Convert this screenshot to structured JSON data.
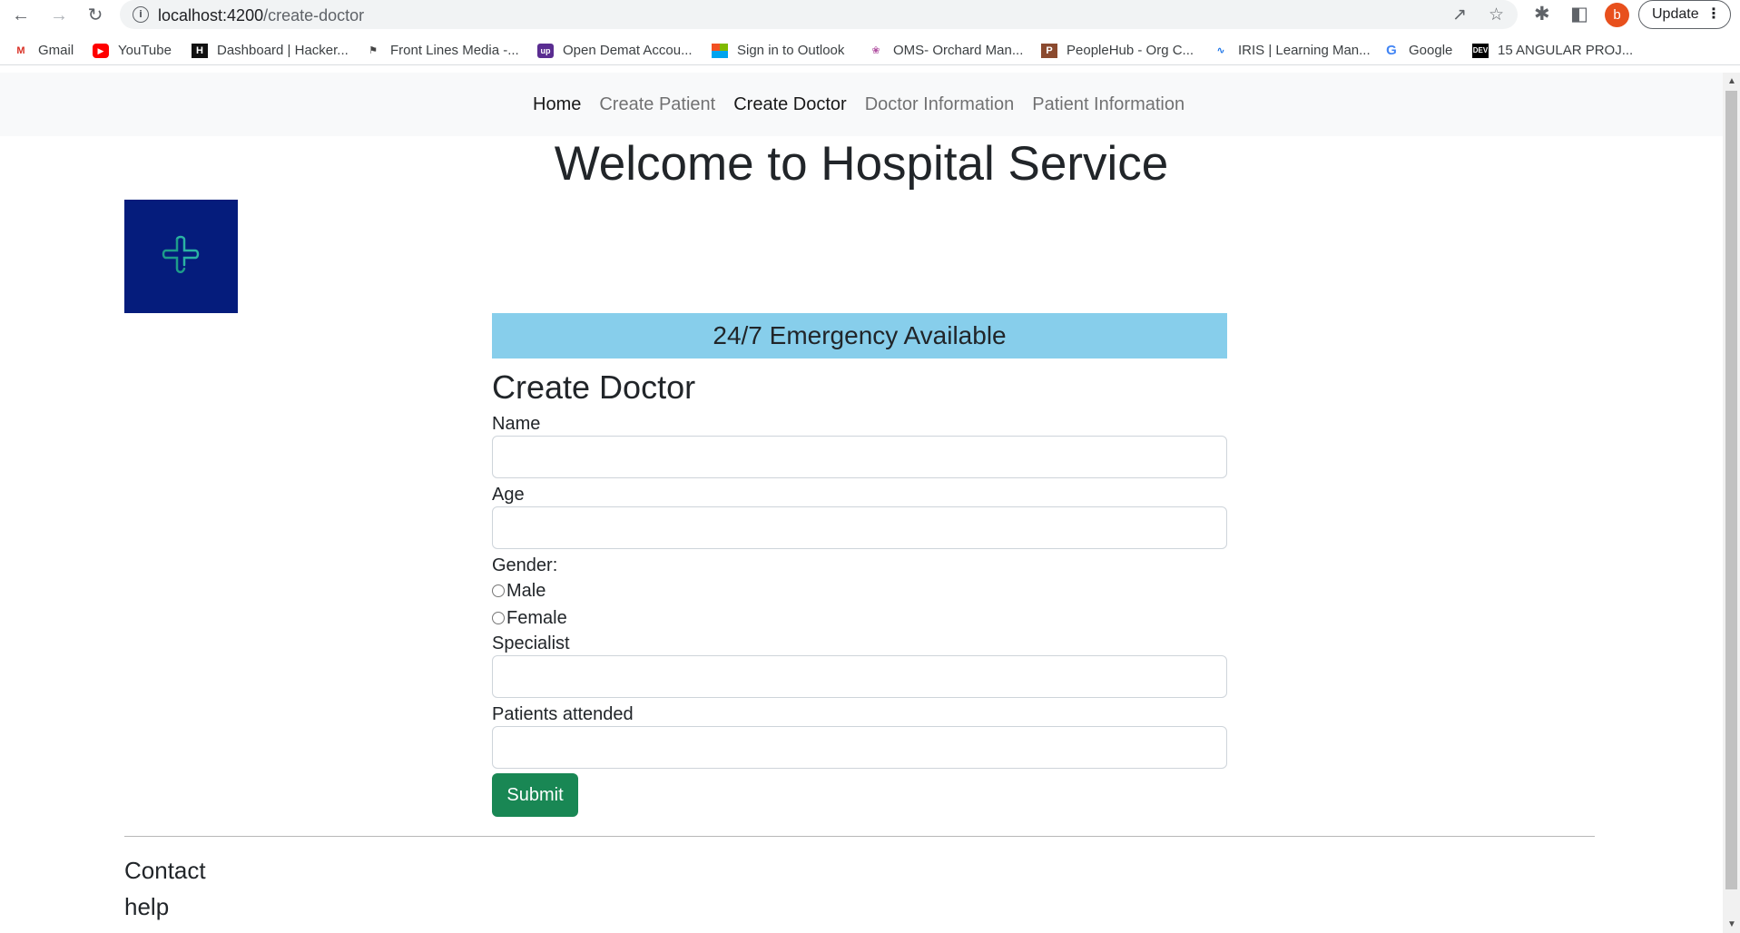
{
  "browser": {
    "url_host": "localhost:4200",
    "url_path": "/create-doctor",
    "profile_initial": "b",
    "update_label": "Update",
    "bookmarks": [
      {
        "label": "Gmail",
        "icon": "gmail-icon"
      },
      {
        "label": "YouTube",
        "icon": "youtube-icon"
      },
      {
        "label": "Dashboard | Hacker...",
        "icon": "hackerrank-icon"
      },
      {
        "label": "Front Lines Media -...",
        "icon": "flm-icon"
      },
      {
        "label": "Open Demat Accou...",
        "icon": "upstox-icon"
      },
      {
        "label": "Sign in to Outlook",
        "icon": "microsoft-icon"
      },
      {
        "label": "OMS- Orchard Man...",
        "icon": "oms-icon"
      },
      {
        "label": "PeopleHub - Org C...",
        "icon": "peoplehub-icon"
      },
      {
        "label": "IRIS | Learning Man...",
        "icon": "iris-icon"
      },
      {
        "label": "Google",
        "icon": "google-icon"
      },
      {
        "label": "15 ANGULAR PROJ...",
        "icon": "dev-icon"
      }
    ]
  },
  "nav": {
    "items": [
      "Home",
      "Create Patient",
      "Create Doctor",
      "Doctor Information",
      "Patient Information"
    ]
  },
  "page": {
    "title": "Welcome to Hospital Service",
    "banner": "24/7 Emergency Available"
  },
  "form": {
    "heading": "Create Doctor",
    "name_label": "Name",
    "age_label": "Age",
    "gender_label": "Gender:",
    "male_label": "Male",
    "female_label": "Female",
    "specialist_label": "Specialist",
    "patients_label": "Patients attended",
    "submit_label": "Submit"
  },
  "footer": {
    "contact": "Contact",
    "help": "help"
  },
  "colors": {
    "banner": "#87ceeb",
    "logo_bg": "#051c7c",
    "submit": "#198754"
  }
}
